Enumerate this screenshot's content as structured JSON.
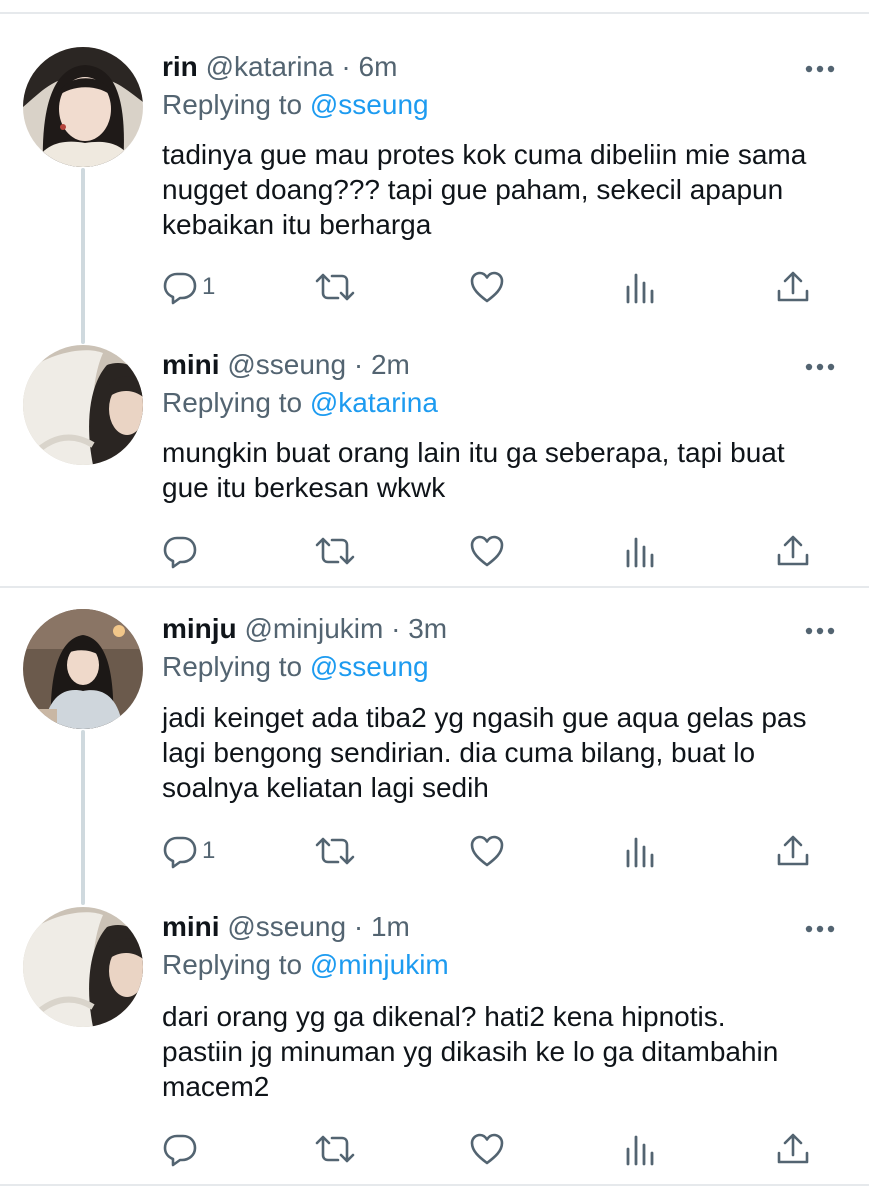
{
  "tweets": [
    {
      "name": "rin",
      "handle": "@katarina",
      "time": "6m",
      "replying_prefix": "Replying to",
      "replying_to": "@sseung",
      "text_lines": [
        "tadinya gue mau protes kok cuma dibeliin mie sama",
        "nugget doang??? tapi gue paham, sekecil apapun",
        "kebaikan itu berharga"
      ],
      "reply_count": "1"
    },
    {
      "name": "mini",
      "handle": "@sseung",
      "time": "2m",
      "replying_prefix": "Replying to",
      "replying_to": "@katarina",
      "text_lines": [
        "mungkin buat orang lain itu ga seberapa, tapi buat",
        "gue itu berkesan wkwk"
      ],
      "reply_count": ""
    },
    {
      "name": "minju",
      "handle": "@minjukim",
      "time": "3m",
      "replying_prefix": "Replying to",
      "replying_to": "@sseung",
      "text_lines": [
        "jadi keinget ada tiba2 yg ngasih gue aqua gelas pas",
        "lagi bengong sendirian. dia cuma bilang, buat lo",
        "soalnya keliatan lagi sedih"
      ],
      "reply_count": "1"
    },
    {
      "name": "mini",
      "handle": "@sseung",
      "time": "1m",
      "replying_prefix": "Replying to",
      "replying_to": "@minjukim",
      "text_lines": [
        "dari orang yg ga dikenal? hati2 kena hipnotis.",
        "pastiin jg minuman yg dikasih ke lo ga ditambahin",
        "macem2"
      ],
      "reply_count": ""
    }
  ],
  "separator": "·",
  "icons": [
    "more-icon",
    "reply-icon",
    "retweet-icon",
    "like-icon",
    "analytics-icon",
    "share-icon"
  ],
  "colors": {
    "link": "#1d9bf0",
    "secondary": "#536471",
    "thread_line": "#cfd9de"
  }
}
